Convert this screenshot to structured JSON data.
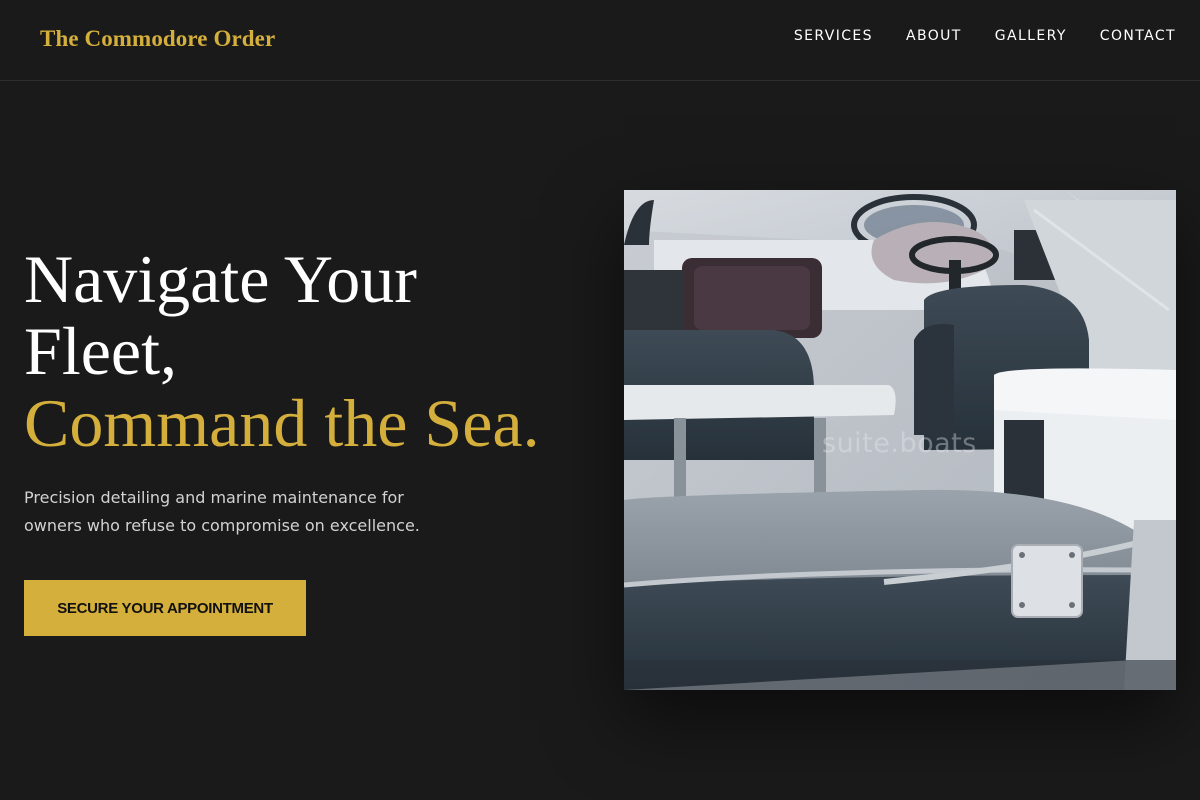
{
  "header": {
    "brand": "The Commodore Order",
    "nav": [
      {
        "label": "SERVICES"
      },
      {
        "label": "ABOUT"
      },
      {
        "label": "GALLERY"
      },
      {
        "label": "CONTACT"
      }
    ]
  },
  "hero": {
    "title_line1": "Navigate Your",
    "title_line2": "Fleet,",
    "title_accent": "Command the Sea.",
    "subtitle": "Precision detailing and marine maintenance for owners who refuse to compromise on excellence.",
    "cta_label": "SECURE YOUR APPOINTMENT",
    "image": {
      "subject": "boat-cockpit-interior-photo",
      "watermark": "suite.boats"
    }
  },
  "colors": {
    "background": "#1a1a1a",
    "accent": "#d4af3c",
    "text": "#ffffff",
    "muted_text": "#d2d2d2"
  }
}
